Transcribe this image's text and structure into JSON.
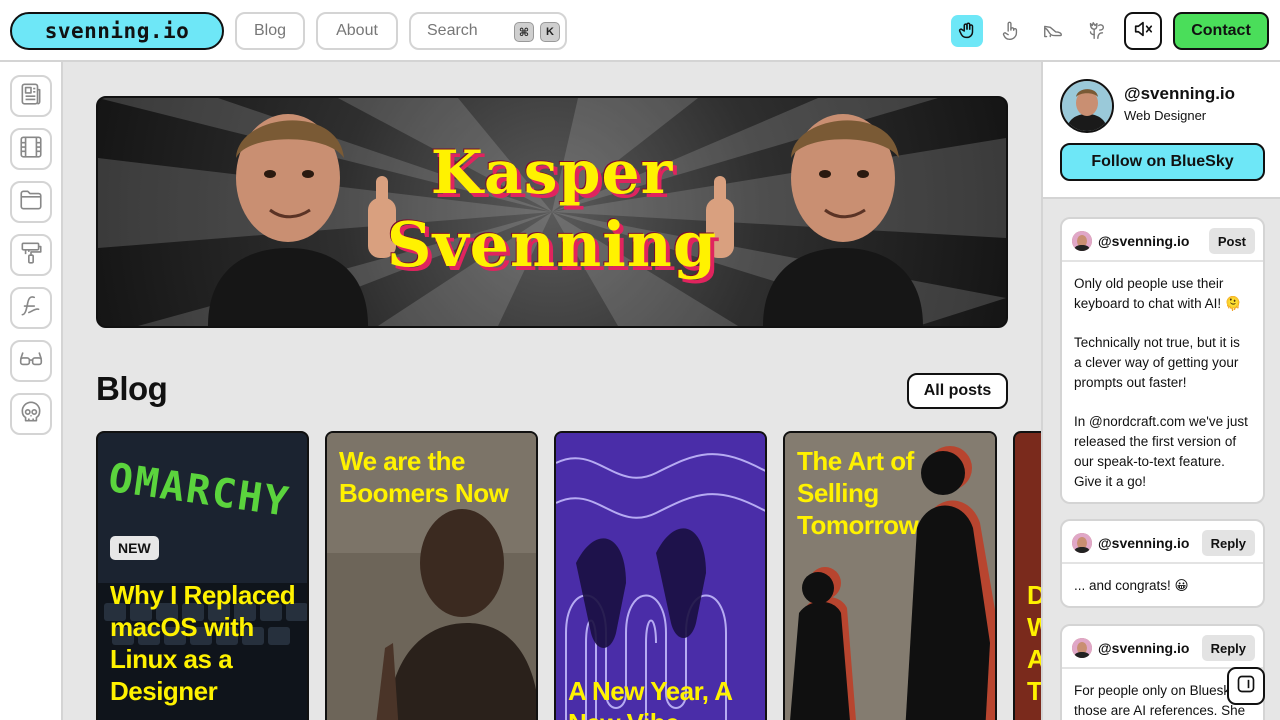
{
  "header": {
    "logo": "svenning.io",
    "nav": {
      "blog": "Blog",
      "about": "About"
    },
    "search": {
      "label": "Search",
      "key_cmd": "⌘",
      "key_k": "K"
    },
    "tools": [
      "hand-cursor-icon",
      "pointing-hand-icon",
      "heel-shoe-icon",
      "tulip-icon"
    ],
    "mute_icon": "speaker-muted-icon",
    "contact": "Contact",
    "accent_color": "#6ee7f7",
    "contact_color": "#4ade5a"
  },
  "sidebar": {
    "items": [
      "newspaper-icon",
      "film-icon",
      "folder-icon",
      "paint-roller-icon",
      "signature-icon",
      "glasses-icon",
      "skull-icon"
    ]
  },
  "banner": {
    "title_line1": "Kasper",
    "title_line2": "Svenning"
  },
  "blog": {
    "title": "Blog",
    "all_posts": "All posts",
    "cards": [
      {
        "title": "Why I Replaced macOS with Linux as a Designer",
        "badge": "NEW",
        "image_text": "OMARCHY"
      },
      {
        "title": "We are the Boomers Now"
      },
      {
        "title": "A New Year, A New Vibe"
      },
      {
        "title": "The Art of Selling Tomorrow"
      },
      {
        "title": "D W A T"
      }
    ]
  },
  "profile": {
    "handle": "@svenning.io",
    "role": "Web Designer",
    "follow": "Follow on BlueSky"
  },
  "posts": [
    {
      "handle": "@svenning.io",
      "tag": "Post",
      "paragraphs": [
        "Only old people use their keyboard to chat with AI! 🫠",
        "Technically not true, but it is a clever way of getting your prompts out faster!",
        "In @nordcraft.com we've just released the first version of our speak-to-text feature. Give it a go!"
      ]
    },
    {
      "handle": "@svenning.io",
      "tag": "Reply",
      "paragraphs": [
        "... and congrats! 😀"
      ]
    },
    {
      "handle": "@svenning.io",
      "tag": "Reply",
      "paragraphs": [
        "For people only on Bluesky those are AI references. She is"
      ]
    }
  ],
  "panel_toggle_icon": "sidebar-panel-icon"
}
